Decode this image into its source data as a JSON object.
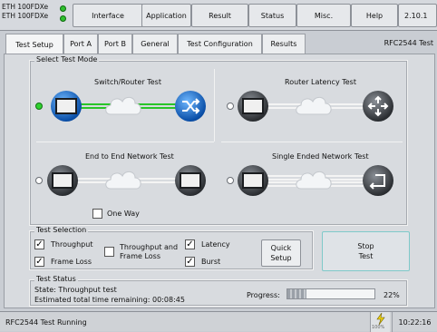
{
  "device": {
    "line1": "ETH 100FDXe",
    "line2": "ETH 100FDXe"
  },
  "top_tabs": [
    "Interface",
    "Application",
    "Result",
    "Status",
    "Misc.",
    "Help",
    "2.10.1"
  ],
  "sub_tabs": [
    "Test Setup",
    "Port A",
    "Port B",
    "General",
    "Test Configuration",
    "Results"
  ],
  "test_name": "RFC2544 Test",
  "mode": {
    "label": "Select Test Mode",
    "switch_router": "Switch/Router Test",
    "router_latency": "Router Latency Test",
    "end_to_end": "End to End Network Test",
    "single_ended": "Single Ended Network Test",
    "one_way": "One Way"
  },
  "selection": {
    "label": "Test Selection",
    "throughput": "Throughput",
    "frame_loss": "Frame Loss",
    "throughput_and": "Throughput and",
    "frame_loss2": "Frame Loss",
    "latency": "Latency",
    "burst": "Burst",
    "quick_setup_l1": "Quick",
    "quick_setup_l2": "Setup",
    "stop_l1": "Stop",
    "stop_l2": "Test"
  },
  "status": {
    "label": "Test Status",
    "state": "State: Throughput test",
    "remaining": "Estimated total time remaining: 00:08:45",
    "progress_label": "Progress:",
    "progress_value": "22%",
    "progress_fraction": 0.22
  },
  "statusbar": {
    "text": "RFC2544 Test Running",
    "battery_text": "100%",
    "clock": "10:22:16"
  },
  "colors": {
    "led": "#2fbf2f",
    "active_link": "#28c428",
    "node_blue": "#0a4fa8"
  }
}
